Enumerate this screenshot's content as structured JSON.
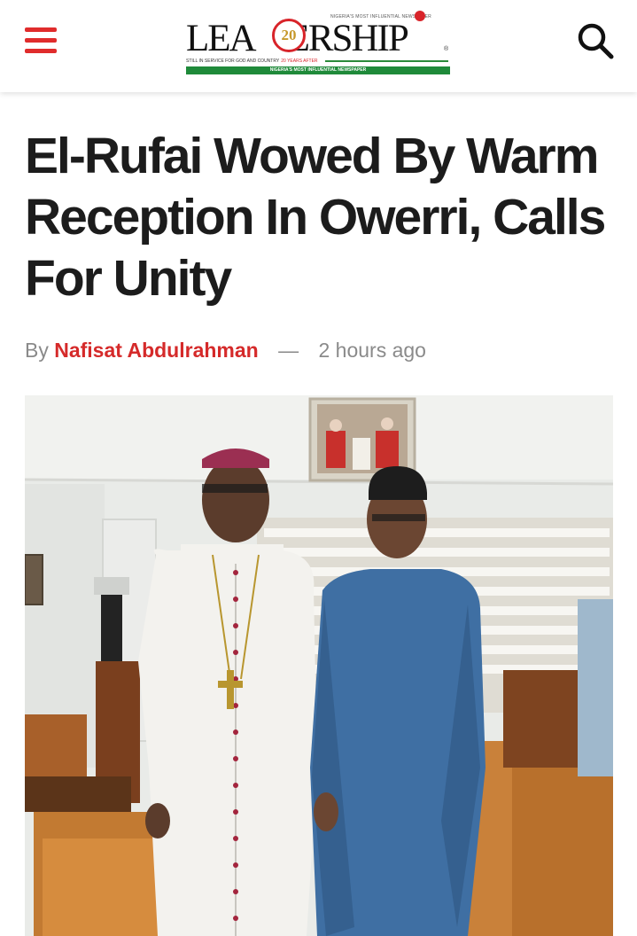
{
  "header": {
    "menu_icon": "hamburger-menu-icon",
    "search_icon": "search-icon",
    "logo": {
      "wordmark": "LEADERSHIP",
      "tagline": "NIGERIA'S MOST INFLUENTIAL NEWSPAPER",
      "strap": "STILL IN SERVICE FOR GOD AND COUNTRY",
      "strap_accent": "20 YEARS AFTER",
      "bar_text": "NIGERIA'S MOST INFLUENTIAL NEWSPAPER",
      "emblem_text": "20"
    },
    "colors": {
      "accent": "#e02c2c",
      "brand_green": "#1f8a3a"
    }
  },
  "article": {
    "headline": "El-Rufai Wowed By Warm Reception In Owerri, Calls For Unity",
    "byline_prefix": "By",
    "author": "Nafisat Abdulrahman",
    "separator": "—",
    "timestamp": "2 hours ago",
    "author_color": "#d52a2a"
  }
}
